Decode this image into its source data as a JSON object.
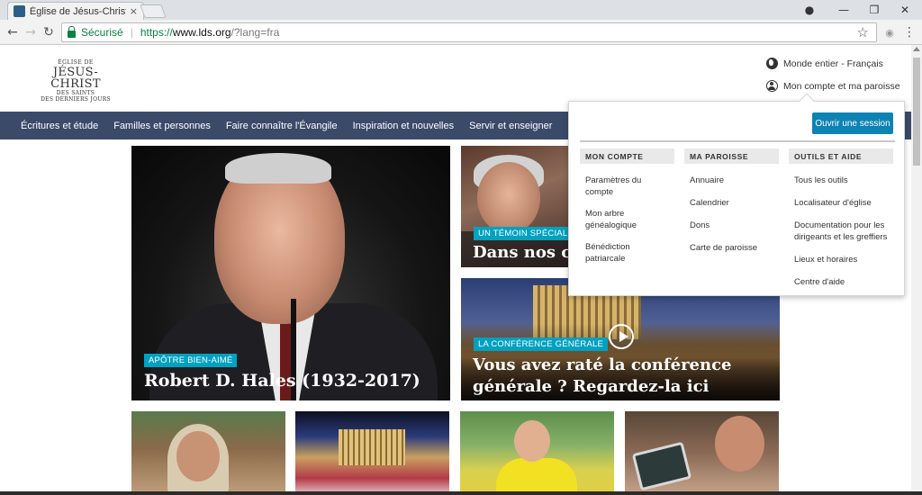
{
  "browser": {
    "tab_title": "Église de Jésus-Christ des",
    "tab_close": "×",
    "secure_label": "Sécurisé",
    "url_scheme": "https://",
    "url_host": "www.lds.org",
    "url_path": "/?lang=fra",
    "back": "←",
    "forward": "→",
    "reload": "↻",
    "star": "☆",
    "menu": "⋮",
    "minimize": "—",
    "restore": "❐",
    "close": "✕",
    "profile": "●"
  },
  "logo": {
    "line1": "ÉGLISE DE",
    "line2": "JÉSUS-CHRIST",
    "line3": "DES SAINTS",
    "line4": "DES DERNIERS JOURS"
  },
  "header": {
    "region_link": "Monde entier - Français",
    "account_link": "Mon compte et ma paroisse"
  },
  "nav": {
    "items": [
      "Écritures et étude",
      "Familles et personnes",
      "Faire connaître l'Évangile",
      "Inspiration et nouvelles",
      "Servir et enseigner"
    ]
  },
  "cards": {
    "hero": {
      "badge": "APÔTRE BIEN-AIMÉ",
      "title": "Robert D. Hales (1932-2017)"
    },
    "temoin": {
      "badge": "UN TÉMOIN SPÉCIAL",
      "title": "Dans nos co"
    },
    "conference": {
      "badge": "LA CONFÉRENCE GÉNÉRALE",
      "title_line1": "Vous avez raté la conférence",
      "title_line2": "générale ? Regardez-la ici"
    }
  },
  "panel": {
    "signin": "Ouvrir une session",
    "columns": [
      {
        "heading": "MON COMPTE",
        "links": [
          "Paramètres du compte",
          "Mon arbre généalogique",
          "Bénédiction patriarcale"
        ]
      },
      {
        "heading": "MA PAROISSE",
        "links": [
          "Annuaire",
          "Calendrier",
          "Dons",
          "Carte de paroisse"
        ]
      },
      {
        "heading": "OUTILS ET AIDE",
        "links": [
          "Tous les outils",
          "Localisateur d'église",
          "Documentation pour les dirigeants et les greffiers",
          "Lieux et horaires",
          "Centre d'aide"
        ]
      }
    ]
  },
  "colors": {
    "nav_bg": "#3b4a69",
    "badge": "#00a1c1",
    "signin": "#0d83b3",
    "secure_green": "#0b8043"
  }
}
